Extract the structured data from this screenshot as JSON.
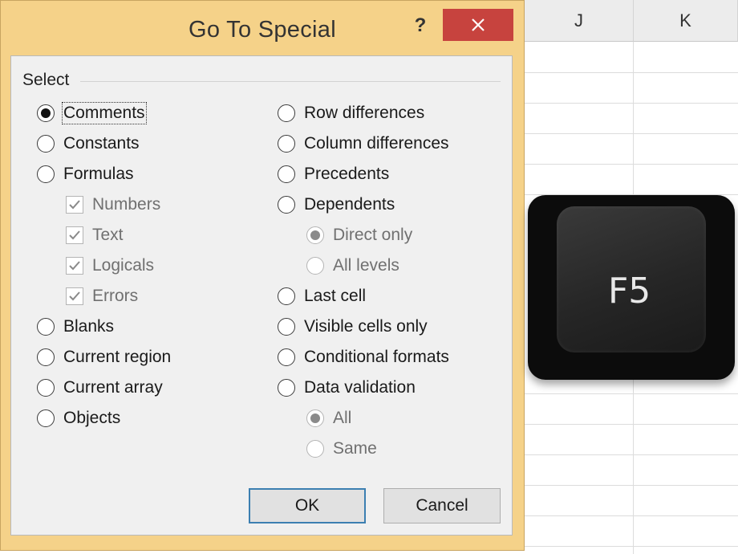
{
  "sheet": {
    "columns": [
      "J",
      "K"
    ]
  },
  "dialog": {
    "title": "Go To Special",
    "help_label": "?",
    "group_label": "Select",
    "left_options": [
      {
        "label": "Comments",
        "checked": true
      },
      {
        "label": "Constants",
        "checked": false
      },
      {
        "label": "Formulas",
        "checked": false
      }
    ],
    "formula_subs": [
      {
        "label": "Numbers",
        "checked": true
      },
      {
        "label": "Text",
        "checked": true
      },
      {
        "label": "Logicals",
        "checked": true
      },
      {
        "label": "Errors",
        "checked": true
      }
    ],
    "left_options_2": [
      {
        "label": "Blanks",
        "checked": false
      },
      {
        "label": "Current region",
        "checked": false
      },
      {
        "label": "Current array",
        "checked": false
      },
      {
        "label": "Objects",
        "checked": false
      }
    ],
    "right_options": [
      {
        "label": "Row differences",
        "checked": false
      },
      {
        "label": "Column differences",
        "checked": false
      },
      {
        "label": "Precedents",
        "checked": false
      },
      {
        "label": "Dependents",
        "checked": false
      }
    ],
    "dependents_subs": [
      {
        "label": "Direct only",
        "checked": true
      },
      {
        "label": "All levels",
        "checked": false
      }
    ],
    "right_options_2": [
      {
        "label": "Last cell",
        "checked": false
      },
      {
        "label": "Visible cells only",
        "checked": false
      },
      {
        "label": "Conditional formats",
        "checked": false
      },
      {
        "label": "Data validation",
        "checked": false
      }
    ],
    "validation_subs": [
      {
        "label": "All",
        "checked": true
      },
      {
        "label": "Same",
        "checked": false
      }
    ],
    "ok_label": "OK",
    "cancel_label": "Cancel"
  },
  "key": {
    "label": "F5"
  },
  "colors": {
    "dialog_frame": "#f5d289",
    "close_button": "#c7433e",
    "client_bg": "#f0f0f0",
    "default_button_border": "#3c7fb1"
  },
  "icons": {
    "close": "close-icon",
    "help": "help-icon",
    "checkmark": "checkmark-icon"
  }
}
